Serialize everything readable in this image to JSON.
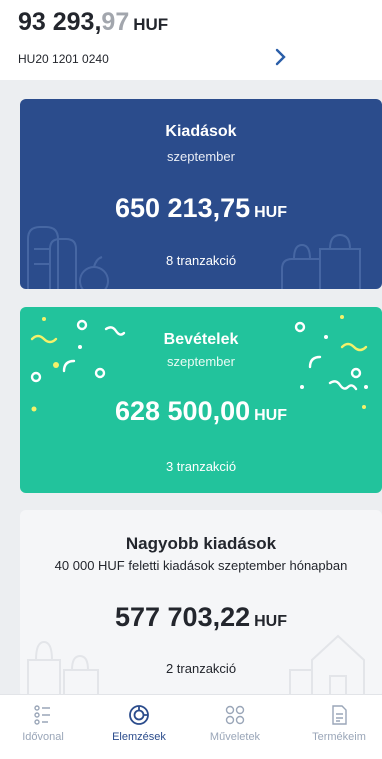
{
  "account": {
    "balance_main": "93 293,",
    "balance_dec": "97",
    "currency": "HUF",
    "iban": "HU20 1201 0240",
    "chevron": "›"
  },
  "expenses": {
    "title": "Kiadások",
    "period": "szeptember",
    "amount": "650 213,75",
    "currency": "HUF",
    "count": "8 tranzakció",
    "color": "#2b4c8c"
  },
  "income": {
    "title": "Bevételek",
    "period": "szeptember",
    "amount": "628 500,00",
    "currency": "HUF",
    "count": "3 tranzakció",
    "color": "#22c39c"
  },
  "large_expenses": {
    "title": "Nagyobb kiadások",
    "subtitle": "40 000 HUF feletti kiadások szeptember hónapban",
    "amount": "577 703,22",
    "currency": "HUF",
    "count": "2 tranzakció"
  },
  "tabbar": {
    "tabs": [
      {
        "label": "Idővonal",
        "icon": "timeline-icon"
      },
      {
        "label": "Elemzések",
        "icon": "analytics-icon",
        "active": true
      },
      {
        "label": "Műveletek",
        "icon": "operations-icon"
      },
      {
        "label": "Termékeim",
        "icon": "products-icon"
      }
    ]
  }
}
